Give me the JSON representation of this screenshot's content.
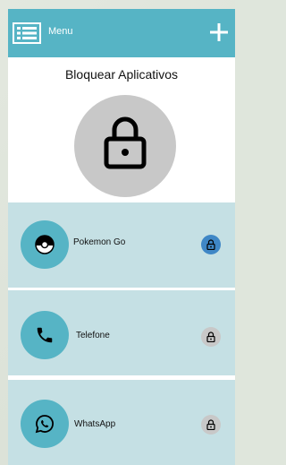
{
  "header": {
    "menu_label": "Menu",
    "menu_icon": "list-icon",
    "add_icon": "plus-icon",
    "color": "#56b4c5"
  },
  "hero": {
    "title": "Bloquear Aplicativos",
    "icon": "lock-icon"
  },
  "apps": [
    {
      "name": "Pokemon Go",
      "icon": "pokeball-icon",
      "locked": true,
      "lock_color": "#3f87c6"
    },
    {
      "name": "Telefone",
      "icon": "phone-icon",
      "locked": false,
      "lock_color": "#c8c8c8"
    },
    {
      "name": "WhatsApp",
      "icon": "whatsapp-icon",
      "locked": false,
      "lock_color": "#c8c8c8"
    }
  ],
  "colors": {
    "card_bg": "#c5e0e4",
    "accent": "#56b4c5"
  }
}
